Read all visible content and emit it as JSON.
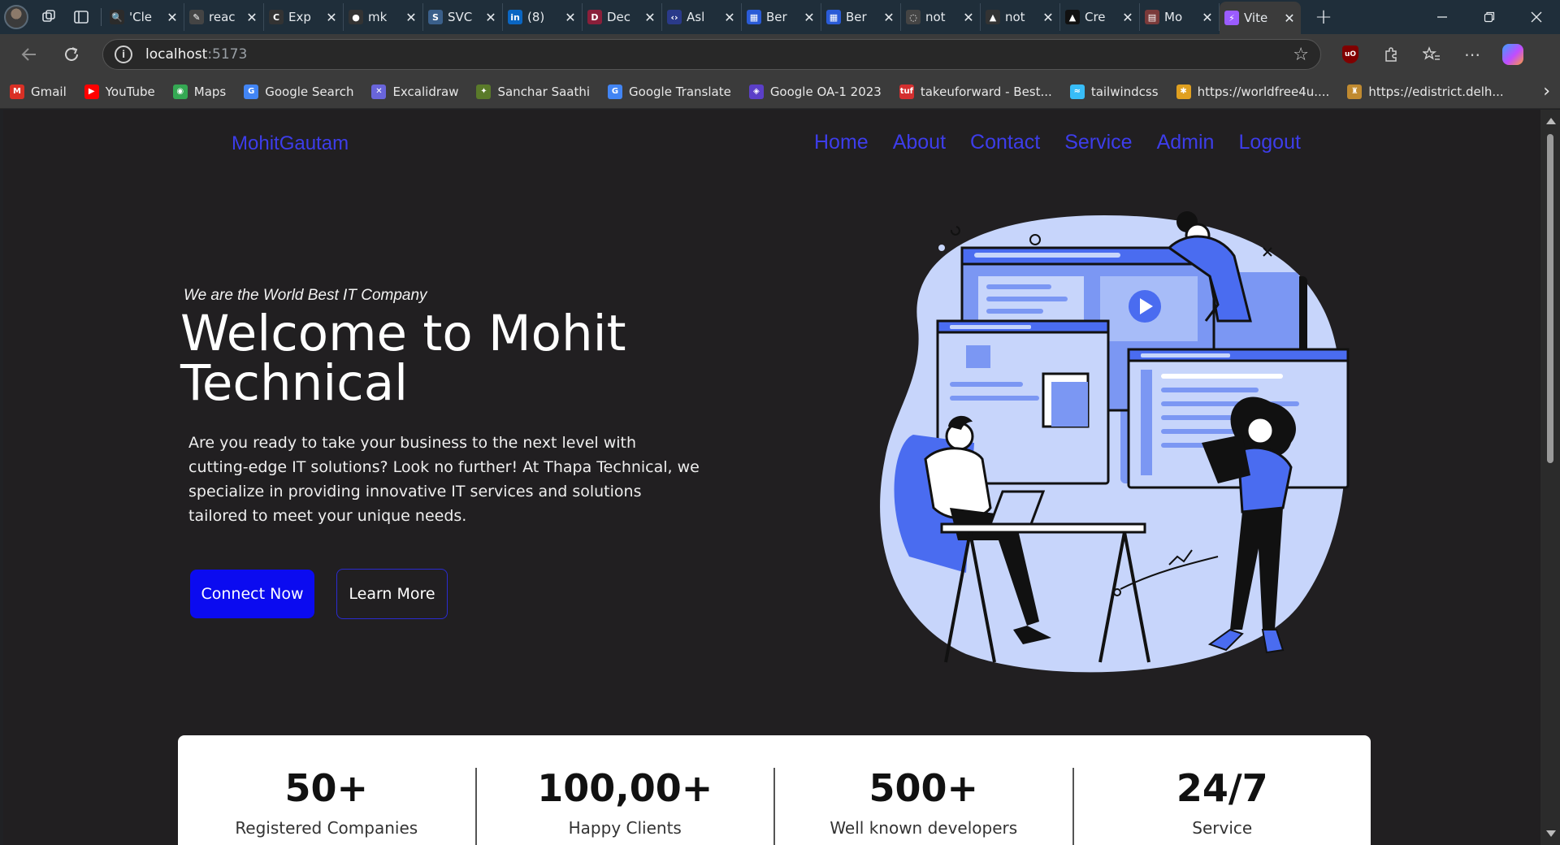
{
  "browser": {
    "tabs": [
      {
        "title": "'Cle",
        "favicon_color": "#2b2b2b",
        "favicon_glyph": "🔍"
      },
      {
        "title": "reac",
        "favicon_color": "#444444",
        "favicon_glyph": "✎"
      },
      {
        "title": "Exp",
        "favicon_color": "#333333",
        "favicon_glyph": "C"
      },
      {
        "title": "mk",
        "favicon_color": "#333333",
        "favicon_glyph": "●"
      },
      {
        "title": "SVC",
        "favicon_color": "#3a5f8a",
        "favicon_glyph": "S"
      },
      {
        "title": "(8)",
        "favicon_color": "#0a66c2",
        "favicon_glyph": "in"
      },
      {
        "title": "Dec",
        "favicon_color": "#8a1f3a",
        "favicon_glyph": "D"
      },
      {
        "title": "Asl",
        "favicon_color": "#2a3a8a",
        "favicon_glyph": "‹›"
      },
      {
        "title": "Ber",
        "favicon_color": "#2a5bd7",
        "favicon_glyph": "▦"
      },
      {
        "title": "Ber",
        "favicon_color": "#2a5bd7",
        "favicon_glyph": "▦"
      },
      {
        "title": "not",
        "favicon_color": "#444444",
        "favicon_glyph": "◌"
      },
      {
        "title": "not",
        "favicon_color": "#333333",
        "favicon_glyph": "▲"
      },
      {
        "title": "Cre",
        "favicon_color": "#111111",
        "favicon_glyph": "▲"
      },
      {
        "title": "Mo",
        "favicon_color": "#7a3a3a",
        "favicon_glyph": "▤"
      },
      {
        "title": "Vite",
        "favicon_color": "#9b5cff",
        "favicon_glyph": "⚡",
        "active": true
      }
    ],
    "new_tab_glyph": "+",
    "address": {
      "host": "localhost",
      "port": ":5173"
    },
    "bookmarks": [
      {
        "label": "Gmail",
        "color": "#d93025",
        "glyph": "M"
      },
      {
        "label": "YouTube",
        "color": "#ff0000",
        "glyph": "▶"
      },
      {
        "label": "Maps",
        "color": "#34a853",
        "glyph": "◉"
      },
      {
        "label": "Google Search",
        "color": "#4285f4",
        "glyph": "G"
      },
      {
        "label": "Excalidraw",
        "color": "#6965db",
        "glyph": "✕"
      },
      {
        "label": "Sanchar Saathi",
        "color": "#5a7a2a",
        "glyph": "✦"
      },
      {
        "label": "Google Translate",
        "color": "#4285f4",
        "glyph": "G"
      },
      {
        "label": "Google OA-1 2023",
        "color": "#5b3fc8",
        "glyph": "◈"
      },
      {
        "label": "takeuforward - Best...",
        "color": "#d32f2f",
        "glyph": "tuf"
      },
      {
        "label": "tailwindcss",
        "color": "#38bdf8",
        "glyph": "≈"
      },
      {
        "label": "https://worldfree4u....",
        "color": "#e0a020",
        "glyph": "✱"
      },
      {
        "label": "https://edistrict.delh...",
        "color": "#c08a30",
        "glyph": "♜"
      }
    ]
  },
  "site": {
    "brand": "MohitGautam",
    "nav": [
      "Home",
      "About",
      "Contact",
      "Service",
      "Admin",
      "Logout"
    ],
    "hero": {
      "tagline": "We are the World Best IT Company",
      "title": "Welcome to Mohit Technical",
      "text": "Are you ready to take your business to the next level with cutting-edge IT solutions? Look no further! At Thapa Technical, we specialize in providing innovative IT services and solutions tailored to meet your unique needs.",
      "primary_button": "Connect Now",
      "secondary_button": "Learn More"
    },
    "stats": [
      {
        "value": "50+",
        "label": "Registered Companies"
      },
      {
        "value": "100,00+",
        "label": "Happy Clients"
      },
      {
        "value": "500+",
        "label": "Well known developers"
      },
      {
        "value": "24/7",
        "label": "Service"
      }
    ]
  },
  "colors": {
    "accent": "#3d3dea",
    "primary_button": "#0b0bf0",
    "page_background": "#211f21",
    "illustration_blue": "#4a6cf0",
    "illustration_light": "#c7d5fb"
  }
}
